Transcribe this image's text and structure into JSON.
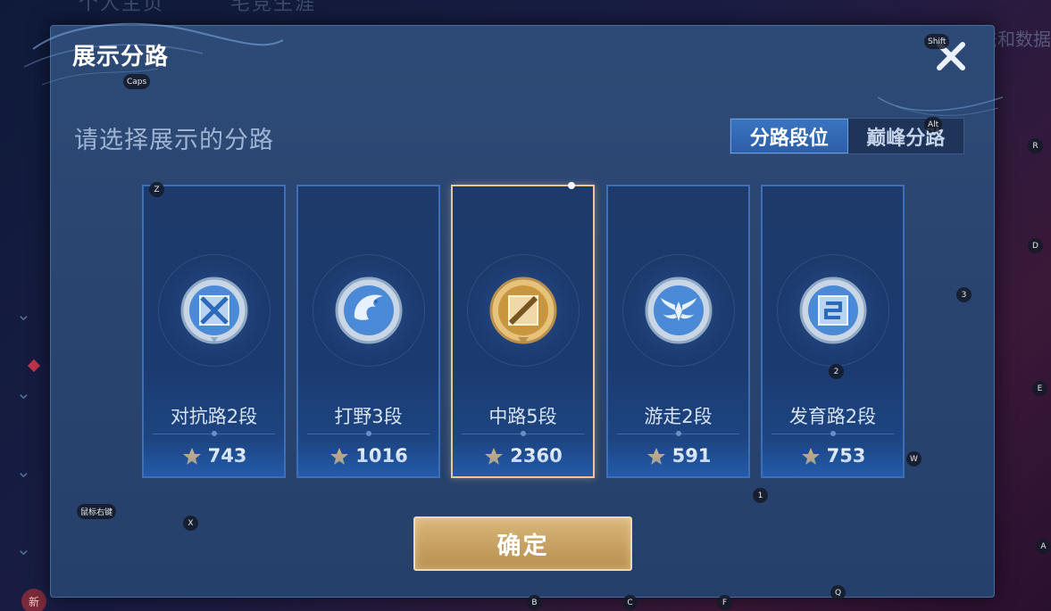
{
  "background": {
    "top_tabs": [
      "个人主页",
      "宅竞生涯"
    ],
    "right_text": "法和数据",
    "new_badge": "新"
  },
  "dialog": {
    "title": "展示分路",
    "subtitle": "请选择展示的分路",
    "tabs": [
      {
        "label": "分路段位",
        "active": true
      },
      {
        "label": "巅峰分路",
        "active": false
      }
    ],
    "cards": [
      {
        "name": "对抗路2段",
        "points": "743",
        "icon": "duel-lane-icon",
        "selected": false
      },
      {
        "name": "打野3段",
        "points": "1016",
        "icon": "jungle-dragon-icon",
        "selected": false
      },
      {
        "name": "中路5段",
        "points": "2360",
        "icon": "mid-lane-icon",
        "selected": true
      },
      {
        "name": "游走2段",
        "points": "591",
        "icon": "roam-wings-icon",
        "selected": false
      },
      {
        "name": "发育路2段",
        "points": "753",
        "icon": "farm-lane-icon",
        "selected": false
      }
    ],
    "confirm_label": "确定"
  },
  "key_hints": {
    "shift": "Shift",
    "caps": "Caps",
    "alt": "Alt",
    "r": "R",
    "z": "Z",
    "d": "D",
    "three": "3",
    "two": "2",
    "e": "E",
    "w": "W",
    "one": "1",
    "mouse_right": "鼠标右键",
    "x": "X",
    "a": "A",
    "q": "Q",
    "b": "B",
    "c": "C",
    "f": "F"
  },
  "colors": {
    "accent_blue": "#3d6fb8",
    "selected_gold": "#e8c79a",
    "confirm_gold": "#d9b67a",
    "tab_active": "#3a74c0"
  }
}
